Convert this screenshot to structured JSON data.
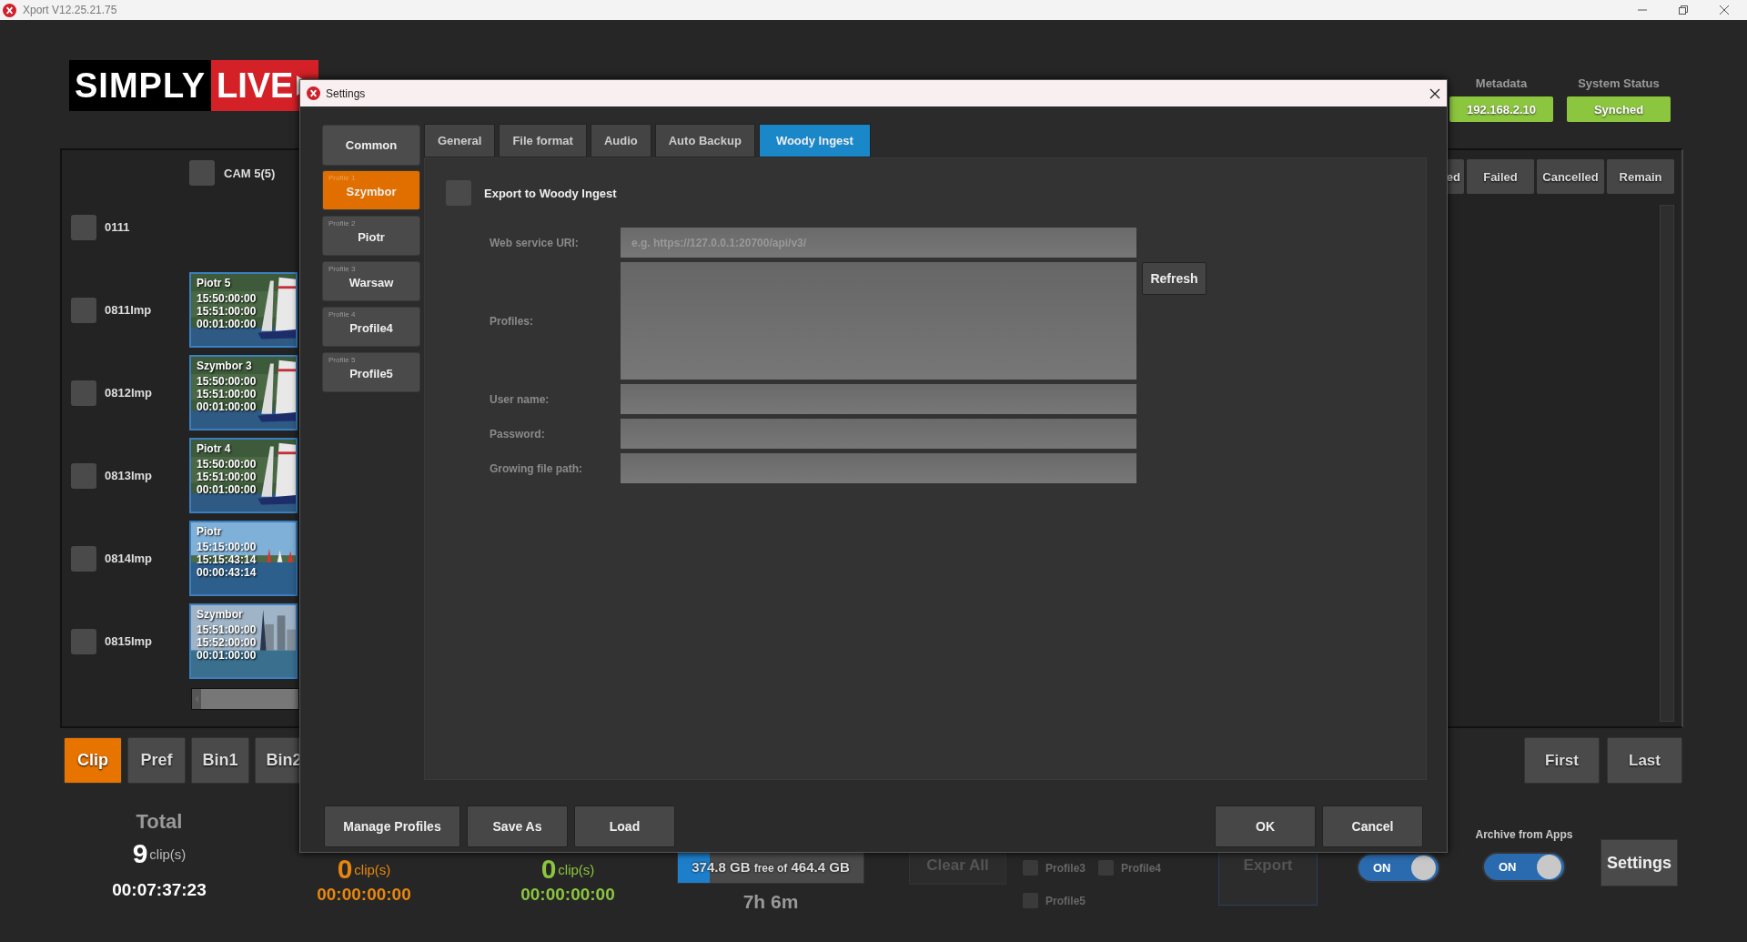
{
  "window": {
    "title": "Xport V12.25.21.75"
  },
  "logo": {
    "first": "SIMPLY",
    "second": "LIVE"
  },
  "header": {
    "metadata": {
      "label": "Metadata",
      "value": "192.168.2.10"
    },
    "system_status": {
      "label": "System Status",
      "value": "Synched"
    }
  },
  "clips_panel": {
    "camera": {
      "label": "CAM 5(5)",
      "checked": false
    },
    "rows": [
      {
        "label": "0111",
        "checked": false
      },
      {
        "label": "0811Imp",
        "checked": false,
        "clip": {
          "name": "Piotr 5",
          "tc_in": "15:50:00:00",
          "tc_out": "15:51:00:00",
          "duration": "00:01:00:00"
        }
      },
      {
        "label": "0812Imp",
        "checked": false,
        "clip": {
          "name": "Szymbor 3",
          "tc_in": "15:50:00:00",
          "tc_out": "15:51:00:00",
          "duration": "00:01:00:00"
        }
      },
      {
        "label": "0813Imp",
        "checked": false,
        "clip": {
          "name": "Piotr 4",
          "tc_in": "15:50:00:00",
          "tc_out": "15:51:00:00",
          "duration": "00:01:00:00"
        }
      },
      {
        "label": "0814Imp",
        "checked": false,
        "clip": {
          "name": "Piotr",
          "tc_in": "15:15:00:00",
          "tc_out": "15:15:43:14",
          "duration": "00:00:43:14"
        }
      },
      {
        "label": "0815Imp",
        "checked": false,
        "clip": {
          "name": "Szymbor",
          "tc_in": "15:51:00:00",
          "tc_out": "15:52:00:00",
          "duration": "00:01:00:00"
        }
      }
    ]
  },
  "queue_panel": {
    "columns": [
      "ed",
      "Failed",
      "Cancelled",
      "Remain"
    ]
  },
  "view_buttons": [
    {
      "label": "Clip",
      "selected": true
    },
    {
      "label": "Pref",
      "selected": false
    },
    {
      "label": "Bin1",
      "selected": false
    },
    {
      "label": "Bin2",
      "selected": false
    }
  ],
  "nav_buttons": [
    "First",
    "Last"
  ],
  "totals": [
    {
      "label": "Total",
      "count": "9",
      "unit": "clip(s)",
      "duration": "00:07:37:23",
      "color": "#ffffff"
    },
    {
      "count": "0",
      "unit": "clip(s)",
      "duration": "00:00:00:00",
      "color": "#e8870e"
    },
    {
      "count": "0",
      "unit": "clip(s)",
      "duration": "00:00:00:00",
      "color": "#8cc63f"
    }
  ],
  "storage": {
    "free": "374.8 GB",
    "free_label": "free of",
    "total": "464.4 GB",
    "level": 0.17,
    "remaining_time": "7h 6m"
  },
  "clear_all": {
    "label": "Clear All",
    "disabled": true
  },
  "export_profiles": [
    {
      "label": "Profile3",
      "checked": false
    },
    {
      "label": "Profile4",
      "checked": false
    },
    {
      "label": "Profile5",
      "checked": false
    }
  ],
  "export_button": {
    "label": "Export",
    "disabled": true
  },
  "export_toggle": {
    "label": "ON",
    "on": true
  },
  "archive": {
    "label": "Archive from Apps",
    "toggle": {
      "label": "ON",
      "on": true
    }
  },
  "settings_button": "Settings",
  "dialog": {
    "title": "Settings",
    "common": "Common",
    "profiles": [
      {
        "number": "Profile 1",
        "name": "Szymbor",
        "selected": true
      },
      {
        "number": "Profile 2",
        "name": "Piotr",
        "selected": false
      },
      {
        "number": "Profile 3",
        "name": "Warsaw",
        "selected": false
      },
      {
        "number": "Profile 4",
        "name": "Profile4",
        "selected": false
      },
      {
        "number": "Profile 5",
        "name": "Profile5",
        "selected": false
      }
    ],
    "tabs": [
      {
        "label": "General",
        "selected": false
      },
      {
        "label": "File format",
        "selected": false
      },
      {
        "label": "Audio",
        "selected": false
      },
      {
        "label": "Auto Backup",
        "selected": false
      },
      {
        "label": "Woody Ingest",
        "selected": true
      }
    ],
    "export_checkbox": {
      "label": "Export to Woody Ingest",
      "checked": false
    },
    "fields": [
      {
        "label": "Web service URI:",
        "kind": "input",
        "placeholder": "e.g. https://127.0.0.1:20700/api/v3/"
      },
      {
        "label": "Profiles:",
        "kind": "list"
      },
      {
        "label": "User name:",
        "kind": "input"
      },
      {
        "label": "Password:",
        "kind": "password"
      },
      {
        "label": "Growing file path:",
        "kind": "input"
      }
    ],
    "refresh": "Refresh",
    "footer_left": [
      "Manage Profiles",
      "Save As",
      "Load"
    ],
    "footer_right": [
      "OK",
      "Cancel"
    ]
  }
}
